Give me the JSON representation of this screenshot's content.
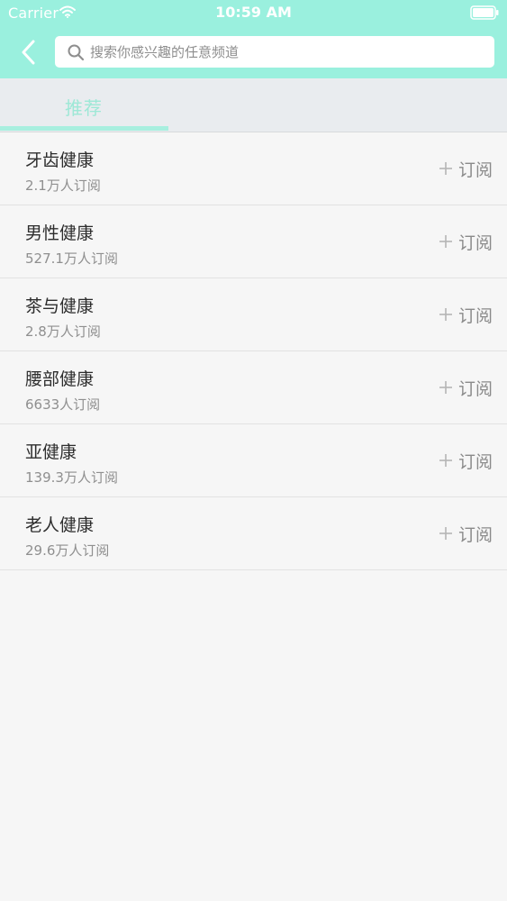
{
  "status_bar": {
    "carrier": "Carrier",
    "time": "10:59 AM"
  },
  "header": {
    "search_placeholder": "搜索你感兴趣的任意频道"
  },
  "tabs": [
    {
      "label": "推荐",
      "active": true
    }
  ],
  "subscribe_label": "订阅",
  "channels": [
    {
      "name": "牙齿健康",
      "subscribers": "2.1万人订阅"
    },
    {
      "name": "男性健康",
      "subscribers": "527.1万人订阅"
    },
    {
      "name": "茶与健康",
      "subscribers": "2.8万人订阅"
    },
    {
      "name": "腰部健康",
      "subscribers": "6633人订阅"
    },
    {
      "name": "亚健康",
      "subscribers": "139.3万人订阅"
    },
    {
      "name": "老人健康",
      "subscribers": "29.6万人订阅"
    }
  ],
  "colors": {
    "header_bg": "#9af0de",
    "tab_accent": "#a8efdf",
    "page_bg": "#f6f6f6"
  }
}
